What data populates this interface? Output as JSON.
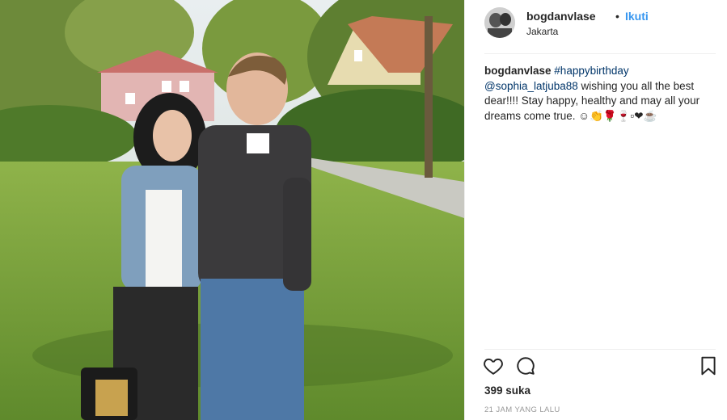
{
  "post": {
    "image_alt": "photo",
    "header": {
      "username": "bogdanvlase",
      "separator": "•",
      "follow_label": "Ikuti",
      "location": "Jakarta"
    },
    "caption": {
      "username": "bogdanvlase",
      "hashtag": "#happybirthday",
      "mention": "@sophia_latjuba88",
      "text": " wishing you all the best dear!!!! Stay happy, healthy and may all your dreams come true. ☺👏🌹🍷▫❤☕"
    },
    "icons": {
      "like": "heart-outline-icon",
      "comment": "comment-bubble-icon",
      "save": "bookmark-icon"
    },
    "likes_text": "399 suka",
    "timestamp": "21 JAM YANG LALU"
  }
}
